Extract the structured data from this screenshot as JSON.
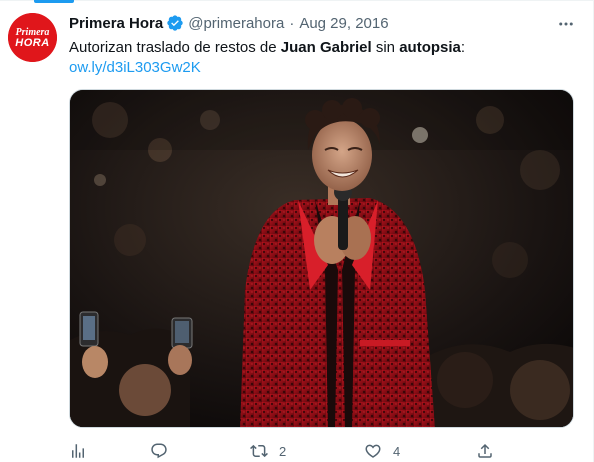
{
  "tweet": {
    "author": {
      "display_name": "Primera Hora",
      "handle": "@primerahora",
      "verified": true,
      "avatar_icon": "primera-hora-logo",
      "avatar_text_top": "Primera",
      "avatar_text_bottom": "HORA"
    },
    "separator": "·",
    "date": "Aug 29, 2016",
    "text": {
      "part1": "Autorizan traslado de restos de ",
      "bold1": "Juan Gabriel",
      "part2": " sin ",
      "bold2": "autopsia",
      "part3": ":"
    },
    "link": "ow.ly/d3iL303Gw2K",
    "media_icon": "concert-photo",
    "actions": {
      "analytics_icon": "analytics-icon",
      "reply_icon": "reply-icon",
      "retweet_icon": "retweet-icon",
      "retweet_count": "2",
      "like_icon": "heart-icon",
      "like_count": "4",
      "share_icon": "share-icon"
    }
  },
  "colors": {
    "accent": "#1d9bf0",
    "text_primary": "#0f1419",
    "text_secondary": "#536471",
    "brand_red": "#e0161b"
  }
}
